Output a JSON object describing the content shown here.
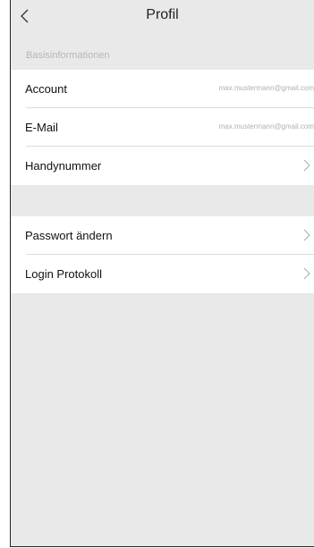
{
  "header": {
    "title": "Profil"
  },
  "section": {
    "label": "Basisinformationen"
  },
  "basic": {
    "account_label": "Account",
    "account_value": "max.mustermann@gmail.com",
    "email_label": "E-Mail",
    "email_value": "max.mustermann@gmail.com",
    "phone_label": "Handynummer"
  },
  "security": {
    "password_label": "Passwort ändern",
    "login_log_label": "Login Protokoll"
  },
  "icons": {
    "back": "chevron-left-icon",
    "row": "chevron-right-icon"
  },
  "colors": {
    "background": "#e9e9e9",
    "card": "#ffffff",
    "muted_text": "#b0b0b0"
  }
}
